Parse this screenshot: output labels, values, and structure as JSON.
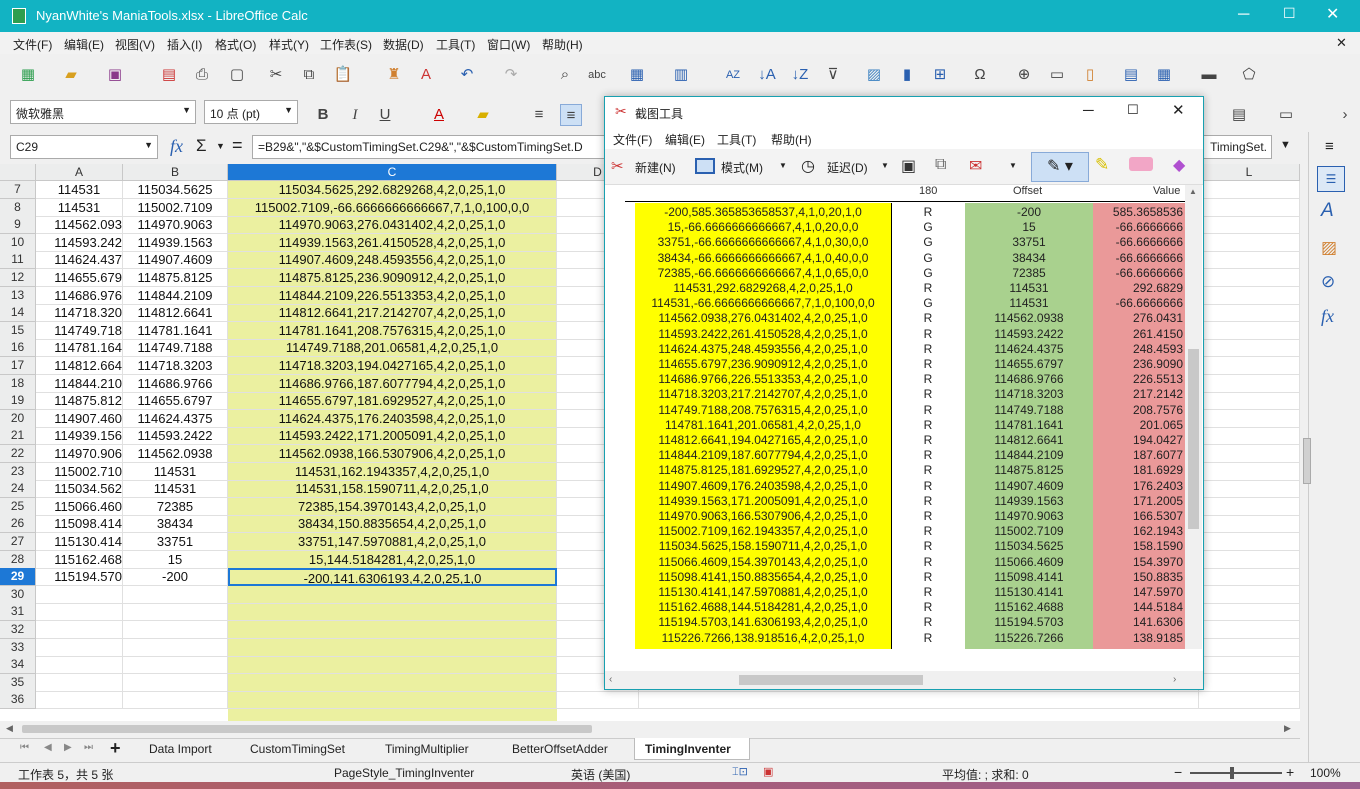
{
  "window": {
    "title": "NyanWhite's ManiaTools.xlsx - LibreOffice Calc"
  },
  "menu": [
    "文件(F)",
    "编辑(E)",
    "视图(V)",
    "插入(I)",
    "格式(O)",
    "样式(Y)",
    "工作表(S)",
    "数据(D)",
    "工具(T)",
    "窗口(W)",
    "帮助(H)"
  ],
  "font": {
    "name": "微软雅黑",
    "size": "10 点 (pt)"
  },
  "formula": {
    "cell_ref": "C29",
    "content": "=B29&\",\"&$CustomTimingSet.C29&\",\"&$CustomTimingSet.D",
    "tail": "TimingSet."
  },
  "sheet": {
    "columns": [
      "A",
      "B",
      "C",
      "D",
      "L"
    ],
    "rows": [
      {
        "n": "7",
        "a": "114531",
        "b": "115034.5625",
        "c": "115034.5625,292.6829268,4,2,0,25,1,0"
      },
      {
        "n": "8",
        "a": "114531",
        "b": "115002.7109",
        "c": "115002.7109,-66.6666666666667,7,1,0,100,0,0"
      },
      {
        "n": "9",
        "a": "114562.093",
        "b": "114970.9063",
        "c": "114970.9063,276.0431402,4,2,0,25,1,0"
      },
      {
        "n": "10",
        "a": "114593.242",
        "b": "114939.1563",
        "c": "114939.1563,261.4150528,4,2,0,25,1,0"
      },
      {
        "n": "11",
        "a": "114624.437",
        "b": "114907.4609",
        "c": "114907.4609,248.4593556,4,2,0,25,1,0"
      },
      {
        "n": "12",
        "a": "114655.679",
        "b": "114875.8125",
        "c": "114875.8125,236.9090912,4,2,0,25,1,0"
      },
      {
        "n": "13",
        "a": "114686.976",
        "b": "114844.2109",
        "c": "114844.2109,226.5513353,4,2,0,25,1,0"
      },
      {
        "n": "14",
        "a": "114718.320",
        "b": "114812.6641",
        "c": "114812.6641,217.2142707,4,2,0,25,1,0"
      },
      {
        "n": "15",
        "a": "114749.718",
        "b": "114781.1641",
        "c": "114781.1641,208.7576315,4,2,0,25,1,0"
      },
      {
        "n": "16",
        "a": "114781.164",
        "b": "114749.7188",
        "c": "114749.7188,201.06581,4,2,0,25,1,0"
      },
      {
        "n": "17",
        "a": "114812.664",
        "b": "114718.3203",
        "c": "114718.3203,194.0427165,4,2,0,25,1,0"
      },
      {
        "n": "18",
        "a": "114844.210",
        "b": "114686.9766",
        "c": "114686.9766,187.6077794,4,2,0,25,1,0"
      },
      {
        "n": "19",
        "a": "114875.812",
        "b": "114655.6797",
        "c": "114655.6797,181.6929527,4,2,0,25,1,0"
      },
      {
        "n": "20",
        "a": "114907.460",
        "b": "114624.4375",
        "c": "114624.4375,176.2403598,4,2,0,25,1,0"
      },
      {
        "n": "21",
        "a": "114939.156",
        "b": "114593.2422",
        "c": "114593.2422,171.2005091,4,2,0,25,1,0"
      },
      {
        "n": "22",
        "a": "114970.906",
        "b": "114562.0938",
        "c": "114562.0938,166.5307906,4,2,0,25,1,0"
      },
      {
        "n": "23",
        "a": "115002.710",
        "b": "114531",
        "c": "114531,162.1943357,4,2,0,25,1,0"
      },
      {
        "n": "24",
        "a": "115034.562",
        "b": "114531",
        "c": "114531,158.1590711,4,2,0,25,1,0"
      },
      {
        "n": "25",
        "a": "115066.460",
        "b": "72385",
        "c": "72385,154.3970143,4,2,0,25,1,0"
      },
      {
        "n": "26",
        "a": "115098.414",
        "b": "38434",
        "c": "38434,150.8835654,4,2,0,25,1,0"
      },
      {
        "n": "27",
        "a": "115130.414",
        "b": "33751",
        "c": "33751,147.5970881,4,2,0,25,1,0"
      },
      {
        "n": "28",
        "a": "115162.468",
        "b": "15",
        "c": "15,144.5184281,4,2,0,25,1,0"
      },
      {
        "n": "29",
        "a": "115194.570",
        "b": "-200",
        "c": "-200,141.6306193,4,2,0,25,1,0"
      },
      {
        "n": "30",
        "a": "",
        "b": "",
        "c": ""
      },
      {
        "n": "31",
        "a": "",
        "b": "",
        "c": ""
      },
      {
        "n": "32",
        "a": "",
        "b": "",
        "c": ""
      },
      {
        "n": "33",
        "a": "",
        "b": "",
        "c": ""
      },
      {
        "n": "34",
        "a": "",
        "b": "",
        "c": ""
      },
      {
        "n": "35",
        "a": "",
        "b": "",
        "c": ""
      },
      {
        "n": "36",
        "a": "",
        "b": "",
        "c": ""
      }
    ]
  },
  "tabs": [
    "Data Import",
    "CustomTimingSet",
    "TimingMultiplier",
    "BetterOffsetAdder",
    "TimingInventer"
  ],
  "status": {
    "sheet": "工作表 5，共 5 张",
    "page_style": "PageStyle_TimingInventer",
    "lang": "英语 (美国)",
    "sum": "平均值: ; 求和: 0",
    "zoom": "100%"
  },
  "snip": {
    "title": "截图工具",
    "menu": [
      "文件(F)",
      "编辑(E)",
      "工具(T)",
      "帮助(H)"
    ],
    "tools": {
      "new": "新建(N)",
      "mode": "模式(M)",
      "delay": "延迟(D)"
    },
    "header_partial": [
      "180",
      "Offset",
      "Value"
    ],
    "rows": [
      {
        "s": "-200,585.365853658537,4,1,0,20,1,0",
        "t": "R",
        "o": "-200",
        "v": "585.3658536"
      },
      {
        "s": "15,-66.6666666666667,4,1,0,20,0,0",
        "t": "G",
        "o": "15",
        "v": "-66.6666666"
      },
      {
        "s": "33751,-66.6666666666667,4,1,0,30,0,0",
        "t": "G",
        "o": "33751",
        "v": "-66.6666666"
      },
      {
        "s": "38434,-66.6666666666667,4,1,0,40,0,0",
        "t": "G",
        "o": "38434",
        "v": "-66.6666666"
      },
      {
        "s": "72385,-66.6666666666667,4,1,0,65,0,0",
        "t": "G",
        "o": "72385",
        "v": "-66.6666666"
      },
      {
        "s": "114531,292.6829268,4,2,0,25,1,0",
        "t": "R",
        "o": "114531",
        "v": "292.6829"
      },
      {
        "s": "114531,-66.6666666666667,7,1,0,100,0,0",
        "t": "G",
        "o": "114531",
        "v": "-66.6666666"
      },
      {
        "s": "114562.0938,276.0431402,4,2,0,25,1,0",
        "t": "R",
        "o": "114562.0938",
        "v": "276.0431"
      },
      {
        "s": "114593.2422,261.4150528,4,2,0,25,1,0",
        "t": "R",
        "o": "114593.2422",
        "v": "261.4150"
      },
      {
        "s": "114624.4375,248.4593556,4,2,0,25,1,0",
        "t": "R",
        "o": "114624.4375",
        "v": "248.4593"
      },
      {
        "s": "114655.6797,236.9090912,4,2,0,25,1,0",
        "t": "R",
        "o": "114655.6797",
        "v": "236.9090"
      },
      {
        "s": "114686.9766,226.5513353,4,2,0,25,1,0",
        "t": "R",
        "o": "114686.9766",
        "v": "226.5513"
      },
      {
        "s": "114718.3203,217.2142707,4,2,0,25,1,0",
        "t": "R",
        "o": "114718.3203",
        "v": "217.2142"
      },
      {
        "s": "114749.7188,208.7576315,4,2,0,25,1,0",
        "t": "R",
        "o": "114749.7188",
        "v": "208.7576"
      },
      {
        "s": "114781.1641,201.06581,4,2,0,25,1,0",
        "t": "R",
        "o": "114781.1641",
        "v": "201.065"
      },
      {
        "s": "114812.6641,194.0427165,4,2,0,25,1,0",
        "t": "R",
        "o": "114812.6641",
        "v": "194.0427"
      },
      {
        "s": "114844.2109,187.6077794,4,2,0,25,1,0",
        "t": "R",
        "o": "114844.2109",
        "v": "187.6077"
      },
      {
        "s": "114875.8125,181.6929527,4,2,0,25,1,0",
        "t": "R",
        "o": "114875.8125",
        "v": "181.6929"
      },
      {
        "s": "114907.4609,176.2403598,4,2,0,25,1,0",
        "t": "R",
        "o": "114907.4609",
        "v": "176.2403"
      },
      {
        "s": "114939.1563,171.2005091,4,2,0,25,1,0",
        "t": "R",
        "o": "114939.1563",
        "v": "171.2005"
      },
      {
        "s": "114970.9063,166.5307906,4,2,0,25,1,0",
        "t": "R",
        "o": "114970.9063",
        "v": "166.5307"
      },
      {
        "s": "115002.7109,162.1943357,4,2,0,25,1,0",
        "t": "R",
        "o": "115002.7109",
        "v": "162.1943"
      },
      {
        "s": "115034.5625,158.1590711,4,2,0,25,1,0",
        "t": "R",
        "o": "115034.5625",
        "v": "158.1590"
      },
      {
        "s": "115066.4609,154.3970143,4,2,0,25,1,0",
        "t": "R",
        "o": "115066.4609",
        "v": "154.3970"
      },
      {
        "s": "115098.4141,150.8835654,4,2,0,25,1,0",
        "t": "R",
        "o": "115098.4141",
        "v": "150.8835"
      },
      {
        "s": "115130.4141,147.5970881,4,2,0,25,1,0",
        "t": "R",
        "o": "115130.4141",
        "v": "147.5970"
      },
      {
        "s": "115162.4688,144.5184281,4,2,0,25,1,0",
        "t": "R",
        "o": "115162.4688",
        "v": "144.5184"
      },
      {
        "s": "115194.5703,141.6306193,4,2,0,25,1,0",
        "t": "R",
        "o": "115194.5703",
        "v": "141.6306"
      },
      {
        "s": "115226.7266,138.918516,4,2,0,25,1,0",
        "t": "R",
        "o": "115226.7266",
        "v": "138.9185"
      }
    ]
  },
  "colors": {
    "title": "#12b3c3",
    "col_c_fill": "#ebf0a0",
    "selected_header": "#1d78d6",
    "snip_yellow": "#ffff00",
    "snip_green": "#a9d18e",
    "snip_red": "#ea9999"
  }
}
